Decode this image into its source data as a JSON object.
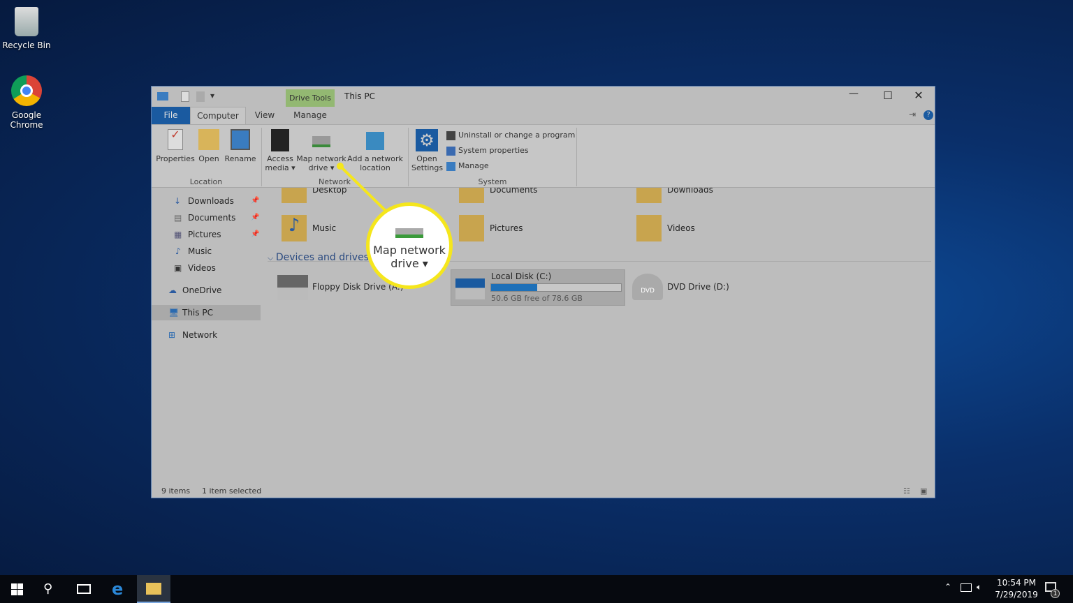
{
  "desktop": {
    "icons": [
      {
        "label": "Recycle Bin",
        "icon": "recycle-bin-icon"
      },
      {
        "label": "Google Chrome",
        "icon": "chrome-icon"
      }
    ]
  },
  "window": {
    "title": "This PC",
    "context_tab_group": "Drive Tools",
    "tabs": [
      {
        "label": "File"
      },
      {
        "label": "Computer"
      },
      {
        "label": "View"
      },
      {
        "label": "Manage"
      }
    ],
    "ribbon": {
      "groups": [
        {
          "label": "Location"
        },
        {
          "label": "Network"
        },
        {
          "label": "System"
        }
      ],
      "location": [
        {
          "label": "Properties"
        },
        {
          "label": "Open"
        },
        {
          "label": "Rename"
        }
      ],
      "network": [
        {
          "label1": "Access",
          "label2": "media ▾"
        },
        {
          "label1": "Map network",
          "label2": "drive ▾"
        },
        {
          "label1": "Add a network",
          "label2": "location"
        }
      ],
      "open_settings": {
        "label1": "Open",
        "label2": "Settings"
      },
      "system": [
        {
          "label": "Uninstall or change a program"
        },
        {
          "label": "System properties"
        },
        {
          "label": "Manage"
        }
      ]
    },
    "sidebar": [
      {
        "label": "Downloads",
        "pinned": true
      },
      {
        "label": "Documents",
        "pinned": true
      },
      {
        "label": "Pictures",
        "pinned": true
      },
      {
        "label": "Music"
      },
      {
        "label": "Videos"
      },
      {
        "label": "OneDrive"
      },
      {
        "label": "This PC",
        "selected": true
      },
      {
        "label": "Network"
      }
    ],
    "folders": [
      {
        "label": "Desktop"
      },
      {
        "label": "Documents"
      },
      {
        "label": "Downloads"
      },
      {
        "label": "Music"
      },
      {
        "label": "Pictures"
      },
      {
        "label": "Videos"
      }
    ],
    "devices_header": "Devices and drives (3)",
    "drives": [
      {
        "label": "Floppy Disk Drive (A:)"
      },
      {
        "label": "Local Disk (C:)",
        "free": "50.6 GB free of 78.6 GB",
        "used_fraction": 0.356,
        "selected": true
      },
      {
        "label": "DVD Drive (D:)"
      }
    ],
    "status": {
      "items": "9 items",
      "selected": "1 item selected"
    }
  },
  "callout": {
    "line1": "Map network",
    "line2": "drive ▾",
    "color": "#f5e61c"
  },
  "taskbar": {
    "time": "10:54 PM",
    "date": "7/29/2019",
    "notifications": "1"
  }
}
